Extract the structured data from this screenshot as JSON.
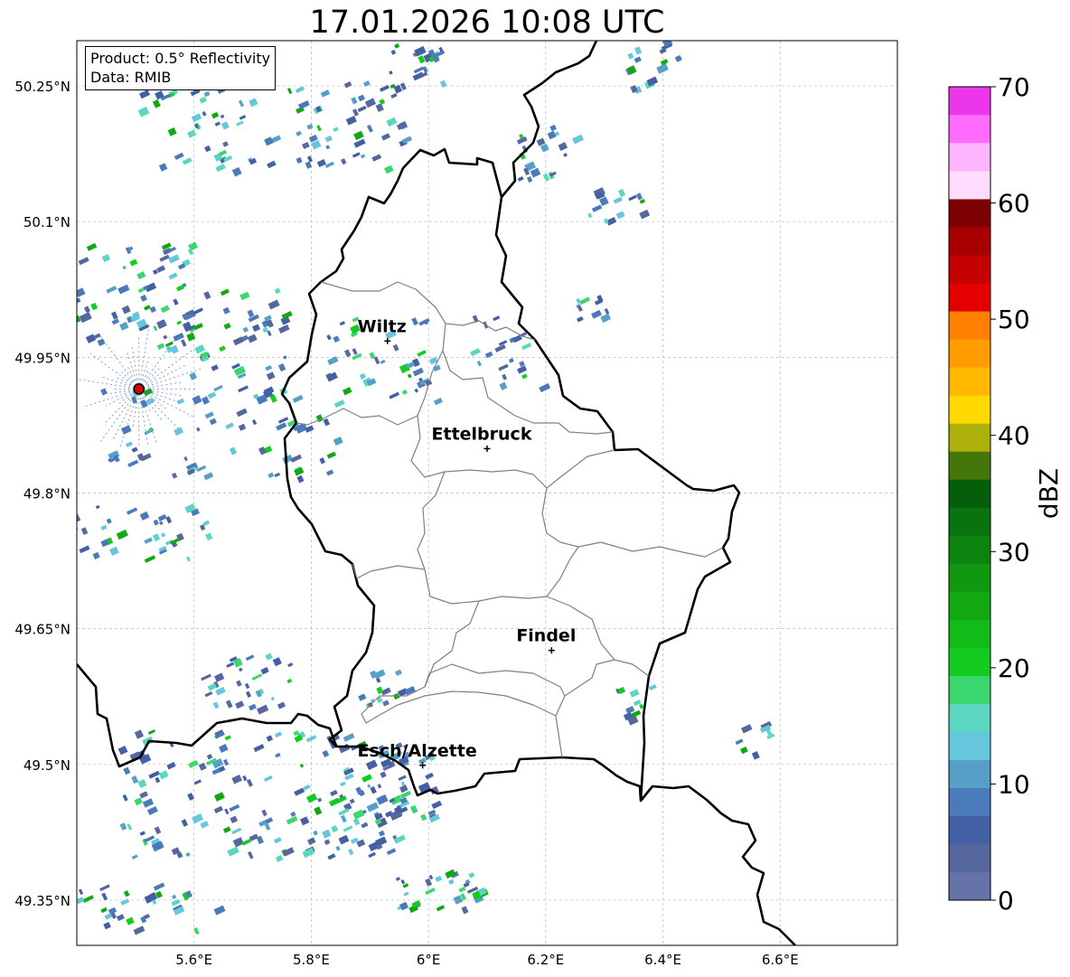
{
  "title": "17.01.2026 10:08 UTC",
  "info": {
    "product": "Product: 0.5° Reflectivity",
    "source": "Data: RMIB"
  },
  "map": {
    "lon_range": [
      5.4,
      6.8
    ],
    "lat_range": [
      49.3,
      50.3
    ],
    "lon_ticks": [
      {
        "value": 5.6,
        "label": "5.6°E"
      },
      {
        "value": 5.8,
        "label": "5.8°E"
      },
      {
        "value": 6.0,
        "label": "6°E"
      },
      {
        "value": 6.2,
        "label": "6.2°E"
      },
      {
        "value": 6.4,
        "label": "6.4°E"
      },
      {
        "value": 6.6,
        "label": "6.6°E"
      }
    ],
    "lat_ticks": [
      {
        "value": 50.25,
        "label": "50.25°N"
      },
      {
        "value": 50.1,
        "label": "50.1°N"
      },
      {
        "value": 49.95,
        "label": "49.95°N"
      },
      {
        "value": 49.8,
        "label": "49.8°N"
      },
      {
        "value": 49.65,
        "label": "49.65°N"
      },
      {
        "value": 49.5,
        "label": "49.5°N"
      },
      {
        "value": 49.35,
        "label": "49.35°N"
      }
    ],
    "cities": [
      {
        "name": "Wiltz",
        "lon": 5.93,
        "lat": 49.968
      },
      {
        "name": "Ettelbruck",
        "lon": 6.1,
        "lat": 49.849
      },
      {
        "name": "Findel",
        "lon": 6.21,
        "lat": 49.626
      },
      {
        "name": "Esch/Alzette",
        "lon": 5.99,
        "lat": 49.499
      }
    ],
    "radar_site": {
      "lon": 5.506,
      "lat": 49.915,
      "color": "#e00000"
    },
    "border_color": "#000000",
    "canton_color": "#808080",
    "grid": true
  },
  "colorbar": {
    "label": "dBZ",
    "min": 0,
    "max": 70,
    "ticks": [
      0,
      10,
      20,
      30,
      40,
      50,
      60,
      70
    ],
    "colors": [
      "#6672a8",
      "#56669f",
      "#4460a4",
      "#4a7aba",
      "#56a0c8",
      "#66c6dc",
      "#5cd6c0",
      "#3cd66e",
      "#14cc20",
      "#12bc18",
      "#12a812",
      "#109810",
      "#0c8410",
      "#087410",
      "#045e0a",
      "#44760a",
      "#acb008",
      "#ffd800",
      "#ffb800",
      "#ff9c00",
      "#ff8000",
      "#e40000",
      "#c40000",
      "#a80000",
      "#7c0000",
      "#ffdcff",
      "#ffb4ff",
      "#ff6cff",
      "#ec36ec"
    ]
  }
}
